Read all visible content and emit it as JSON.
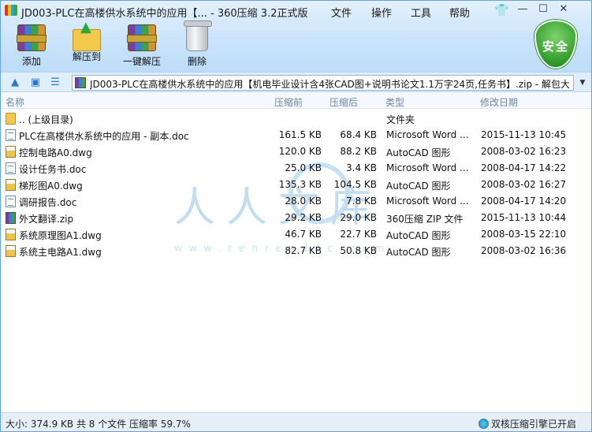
{
  "window": {
    "title": "JD003-PLC在高楼供水系统中的应用【... - 360压缩 3.2正式版",
    "menus": [
      "文件",
      "操作",
      "工具",
      "帮助"
    ]
  },
  "toolbar": {
    "add": "添加",
    "extract_to": "解压到",
    "one_click": "一键解压",
    "delete": "删除"
  },
  "security_badge": "安全",
  "address": {
    "path": "JD003-PLC在高楼供水系统中的应用【机电毕业设计含4张CAD图+说明书论文1.1万字24页,任务书】.zip - 解包大"
  },
  "columns": {
    "name": "名称",
    "size_before": "压缩前",
    "size_after": "压缩后",
    "type": "类型",
    "modified": "修改日期"
  },
  "files": [
    {
      "icon": "folder-icon",
      "name": ".. (上级目录)",
      "size": "",
      "packed": "",
      "type": "文件夹",
      "date": ""
    },
    {
      "icon": "doc-file-icon",
      "name": "PLC在高楼供水系统中的应用 - 副本.doc",
      "size": "161.5 KB",
      "packed": "68.4 KB",
      "type": "Microsoft Word ...",
      "date": "2015-11-13 10:45"
    },
    {
      "icon": "dwg-file-icon",
      "name": "控制电路A0.dwg",
      "size": "120.0 KB",
      "packed": "88.2 KB",
      "type": "AutoCAD 图形",
      "date": "2008-03-02 16:23"
    },
    {
      "icon": "doc-file-icon",
      "name": "设计任务书.doc",
      "size": "25.0 KB",
      "packed": "3.4 KB",
      "type": "Microsoft Word ...",
      "date": "2008-04-17 14:22"
    },
    {
      "icon": "dwg-file-icon",
      "name": "梯形图A0.dwg",
      "size": "135.3 KB",
      "packed": "104.5 KB",
      "type": "AutoCAD 图形",
      "date": "2008-03-02 16:27"
    },
    {
      "icon": "doc-file-icon",
      "name": "调研报告.doc",
      "size": "28.0 KB",
      "packed": "7.8 KB",
      "type": "Microsoft Word ...",
      "date": "2008-04-17 14:20"
    },
    {
      "icon": "zip-file-icon",
      "name": "外文翻译.zip",
      "size": "29.2 KB",
      "packed": "29.0 KB",
      "type": "360压缩 ZIP 文件",
      "date": "2015-11-13 10:44"
    },
    {
      "icon": "dwg-file-icon",
      "name": "系统原理图A1.dwg",
      "size": "46.7 KB",
      "packed": "22.7 KB",
      "type": "AutoCAD 图形",
      "date": "2008-03-15 22:10"
    },
    {
      "icon": "dwg-file-icon",
      "name": "系统主电路A1.dwg",
      "size": "82.7 KB",
      "packed": "50.8 KB",
      "type": "AutoCAD 图形",
      "date": "2008-03-02 16:36"
    }
  ],
  "watermark": {
    "text": "人人文库",
    "url": "www.renrendoc.com"
  },
  "status": {
    "summary": "大小: 374.9 KB 共 8 个文件 压缩率 59.7%",
    "engine": "双核压缩引擎已开启"
  }
}
